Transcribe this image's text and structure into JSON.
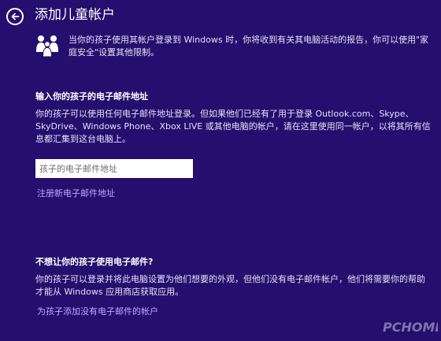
{
  "header": {
    "title": "添加儿童帐户"
  },
  "intro": {
    "text": "当你的孩子使用其帐户登录到 Windows 时，你将收到有关其电脑活动的报告，你可以使用\"家庭安全\"设置其他限制。"
  },
  "email_section": {
    "heading": "输入你的孩子的电子邮件地址",
    "description": "你的孩子可以使用任何电子邮件地址登录。但如果他们已经有了用于登录 Outlook.com、Skype、SkyDrive、Windows Phone、Xbox LIVE 或其他电脑的帐户，请在这里使用同一帐户，以将其所有信息都汇集到这台电脑上。",
    "input_value": "",
    "input_placeholder": "孩子的电子邮件地址",
    "signup_link": "注册新电子邮件地址"
  },
  "no_email_section": {
    "heading": "不想让你的孩子使用电子邮件?",
    "description": "你的孩子可以登录并将此电脑设置为他们想要的外观，但他们没有电子邮件帐户，他们将需要你的帮助才能从 Windows 应用商店获取应用。",
    "add_link": "为孩子添加没有电子邮件的帐户"
  },
  "watermark": {
    "brand": "PCHOME"
  },
  "icons": {
    "back": "back-arrow-icon",
    "family": "family-icon"
  },
  "colors": {
    "background": "#240f6e",
    "link": "#bea8ff",
    "text": "#ffffff"
  }
}
